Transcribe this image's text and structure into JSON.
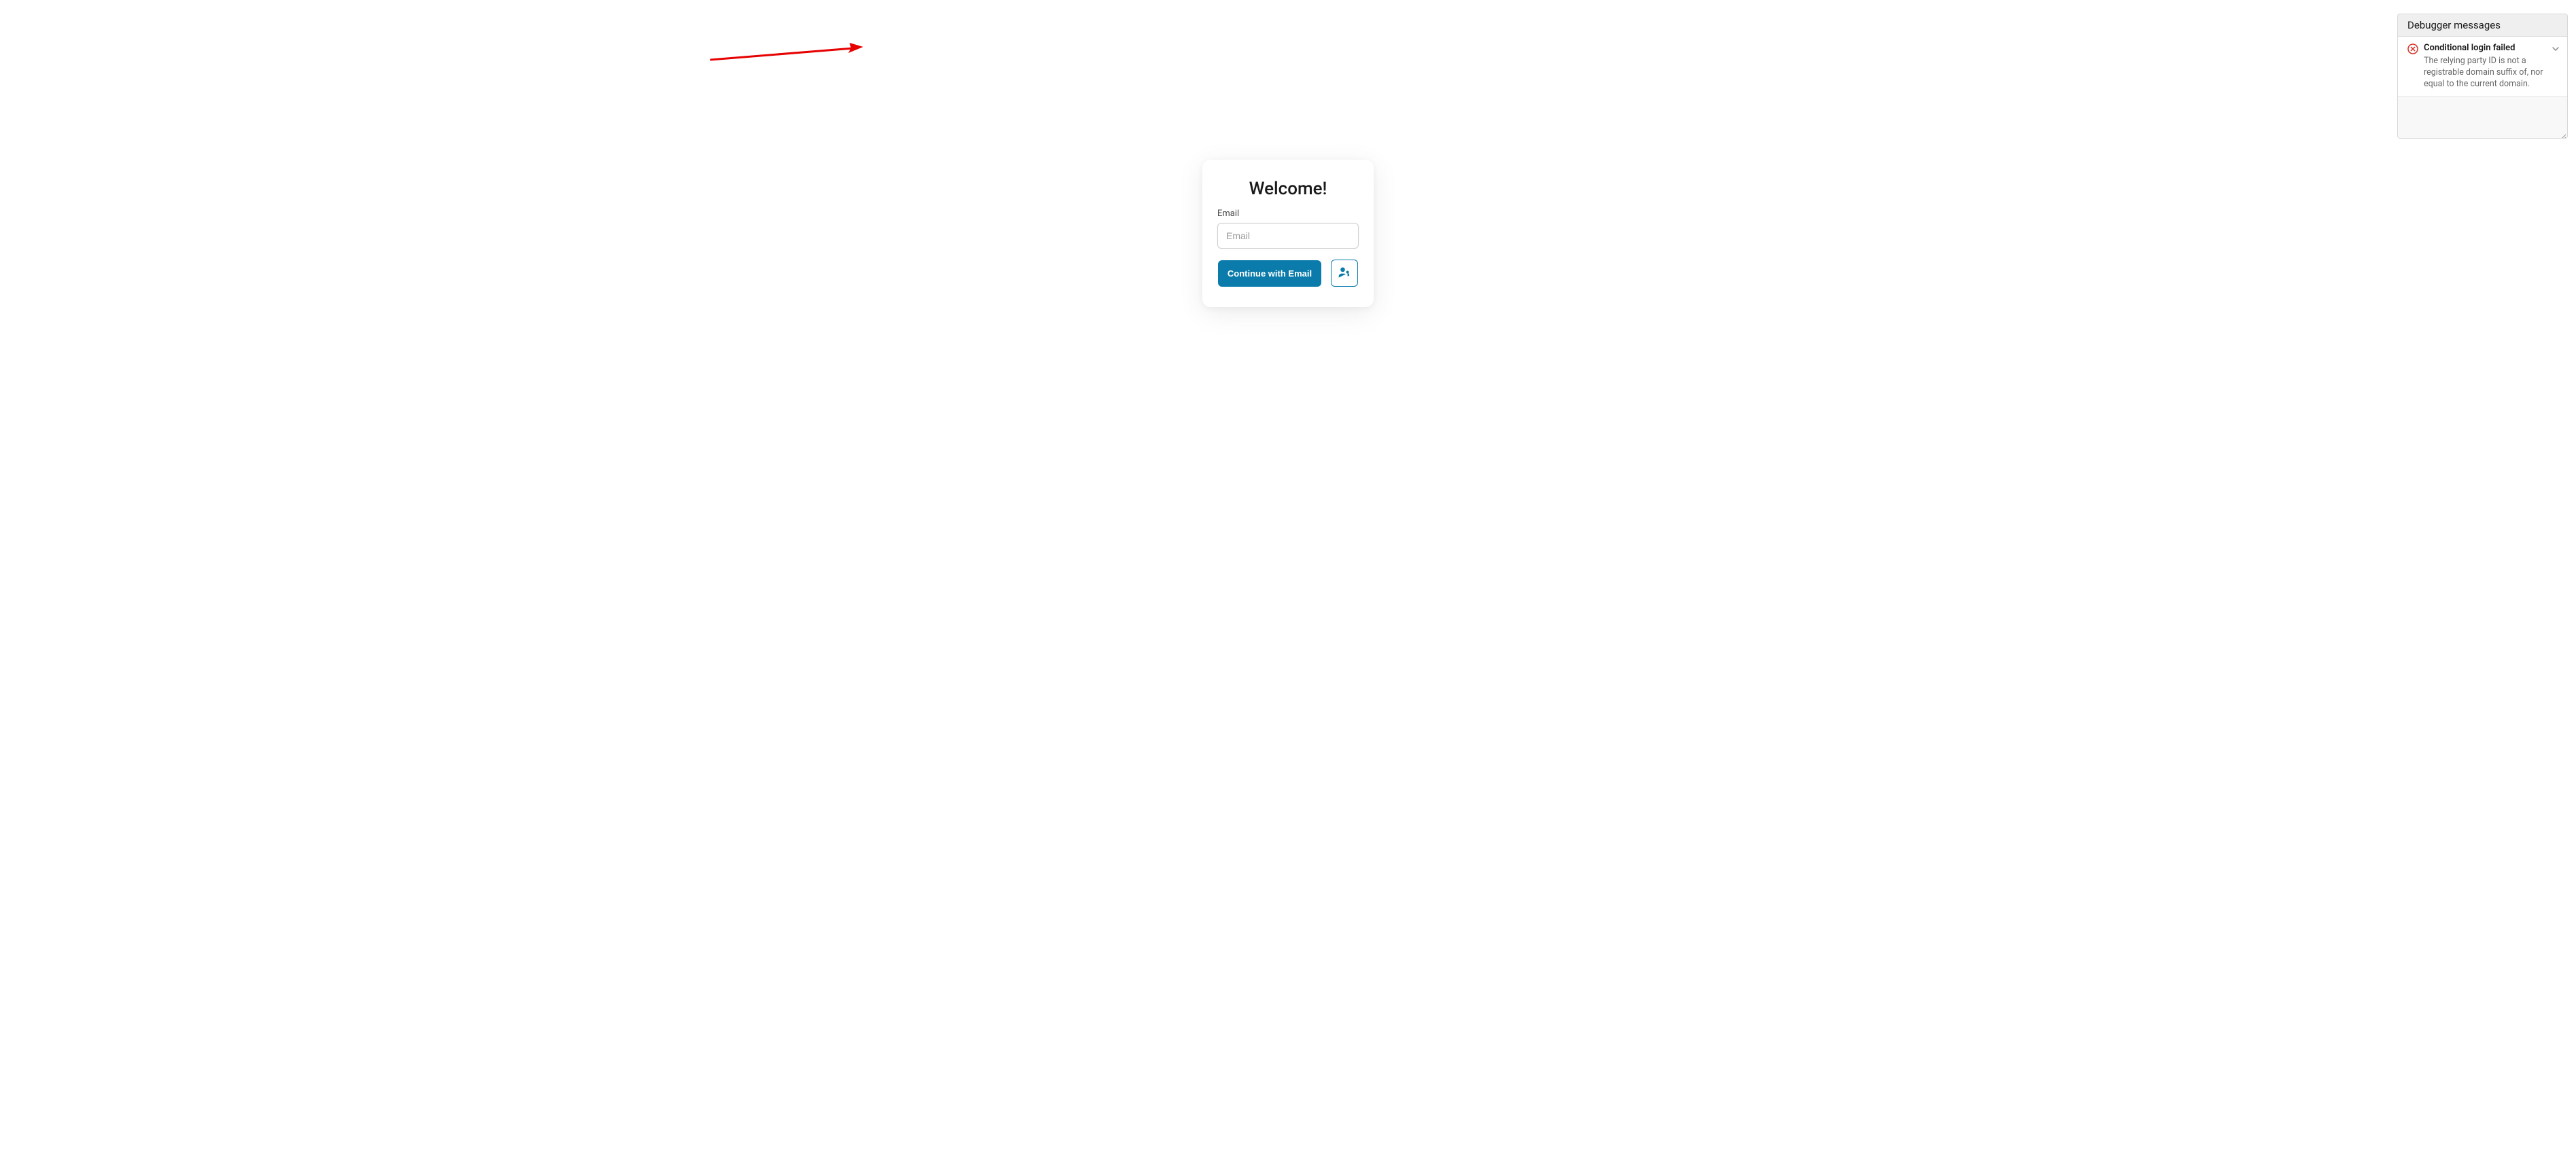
{
  "login": {
    "title": "Welcome!",
    "email_label": "Email",
    "email_placeholder": "Email",
    "email_value": "",
    "continue_button": "Continue with Email"
  },
  "debugger": {
    "header": "Debugger messages",
    "messages": [
      {
        "title": "Conditional login failed",
        "body": "The relying party ID is not a registrable domain suffix of, nor equal to the current domain."
      }
    ]
  }
}
